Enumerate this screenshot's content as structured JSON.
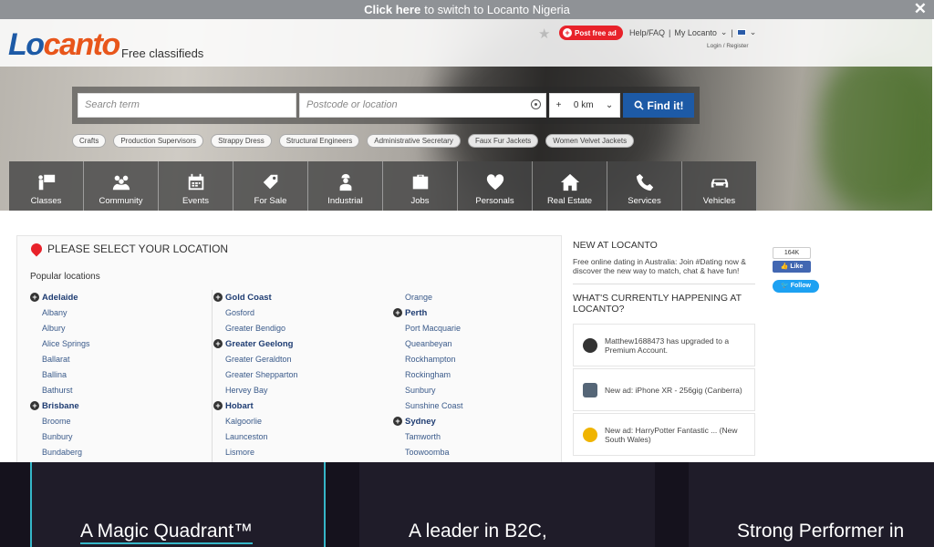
{
  "topbar": {
    "bold": "Click here",
    "rest": "to switch to Locanto Nigeria",
    "close": "✕"
  },
  "header": {
    "logo_a": "Lo",
    "logo_b": "canto",
    "tagline": "Free classifieds",
    "post_ad": "Post free ad",
    "help": "Help/FAQ",
    "my_locanto": "My Locanto",
    "login": "Login / Register"
  },
  "search": {
    "term_placeholder": "Search term",
    "location_placeholder": "Postcode or location",
    "distance_plus": "+",
    "distance_value": "0 km",
    "find_button": "Find it!"
  },
  "tags": [
    "Crafts",
    "Production Supervisors",
    "Strappy Dress",
    "Structural Engineers",
    "Administrative Secretary",
    "Faux Fur Jackets",
    "Women Velvet Jackets"
  ],
  "categories": [
    {
      "label": "Classes",
      "icon": "board-icon"
    },
    {
      "label": "Community",
      "icon": "people-icon"
    },
    {
      "label": "Events",
      "icon": "calendar-icon"
    },
    {
      "label": "For Sale",
      "icon": "tag-icon"
    },
    {
      "label": "Industrial",
      "icon": "worker-icon"
    },
    {
      "label": "Jobs",
      "icon": "briefcase-icon"
    },
    {
      "label": "Personals",
      "icon": "heart-icon"
    },
    {
      "label": "Real Estate",
      "icon": "house-icon"
    },
    {
      "label": "Services",
      "icon": "phone-icon"
    },
    {
      "label": "Vehicles",
      "icon": "car-icon"
    }
  ],
  "locations": {
    "title": "PLEASE SELECT YOUR LOCATION",
    "popular_label": "Popular locations",
    "col1": [
      {
        "name": "Adelaide",
        "major": true
      },
      {
        "name": "Albany"
      },
      {
        "name": "Albury"
      },
      {
        "name": "Alice Springs"
      },
      {
        "name": "Ballarat"
      },
      {
        "name": "Ballina"
      },
      {
        "name": "Bathurst"
      },
      {
        "name": "Brisbane",
        "major": true
      },
      {
        "name": "Broome"
      },
      {
        "name": "Bunbury"
      },
      {
        "name": "Bundaberg"
      }
    ],
    "col2": [
      {
        "name": "Gold Coast",
        "major": true
      },
      {
        "name": "Gosford"
      },
      {
        "name": "Greater Bendigo"
      },
      {
        "name": "Greater Geelong",
        "major": true
      },
      {
        "name": "Greater Geraldton"
      },
      {
        "name": "Greater Shepparton"
      },
      {
        "name": "Hervey Bay"
      },
      {
        "name": "Hobart",
        "major": true
      },
      {
        "name": "Kalgoorlie"
      },
      {
        "name": "Launceston"
      },
      {
        "name": "Lismore"
      }
    ],
    "col3": [
      {
        "name": "Orange"
      },
      {
        "name": "Perth",
        "major": true
      },
      {
        "name": "Port Macquarie"
      },
      {
        "name": "Queanbeyan"
      },
      {
        "name": "Rockhampton"
      },
      {
        "name": "Rockingham"
      },
      {
        "name": "Sunbury"
      },
      {
        "name": "Sunshine Coast"
      },
      {
        "name": "Sydney",
        "major": true
      },
      {
        "name": "Tamworth"
      },
      {
        "name": "Toowoomba"
      }
    ]
  },
  "sidebar": {
    "new_title": "NEW AT LOCANTO",
    "new_text": "Free online dating in Australia: Join #Dating now & discover the new way to match, chat & have fun!",
    "happening_title": "WHAT'S CURRENTLY HAPPENING AT LOCANTO?",
    "activities": [
      {
        "text": "Matthew1688473 has upgraded to a Premium Account.",
        "icon": "premium-badge-icon",
        "color": "#333333"
      },
      {
        "text": "New ad: iPhone XR - 256gig (Canberra)",
        "icon": "phone-ad-icon",
        "color": "#556677"
      },
      {
        "text": "New ad: HarryPotter Fantastic ... (New South Wales)",
        "icon": "person-ad-icon",
        "color": "#f0b400"
      }
    ]
  },
  "social": {
    "fb_count": "164K",
    "fb_like": "Like",
    "tw_follow": "Follow"
  },
  "banner": {
    "card1": "A Magic Quadrant™",
    "card2": "A leader in B2C,",
    "card3": "Strong Performer in"
  },
  "colors": {
    "brand_blue": "#1d5aa6",
    "brand_orange": "#e8561b",
    "post_red": "#e8222a",
    "banner_accent": "#35b6c8"
  }
}
